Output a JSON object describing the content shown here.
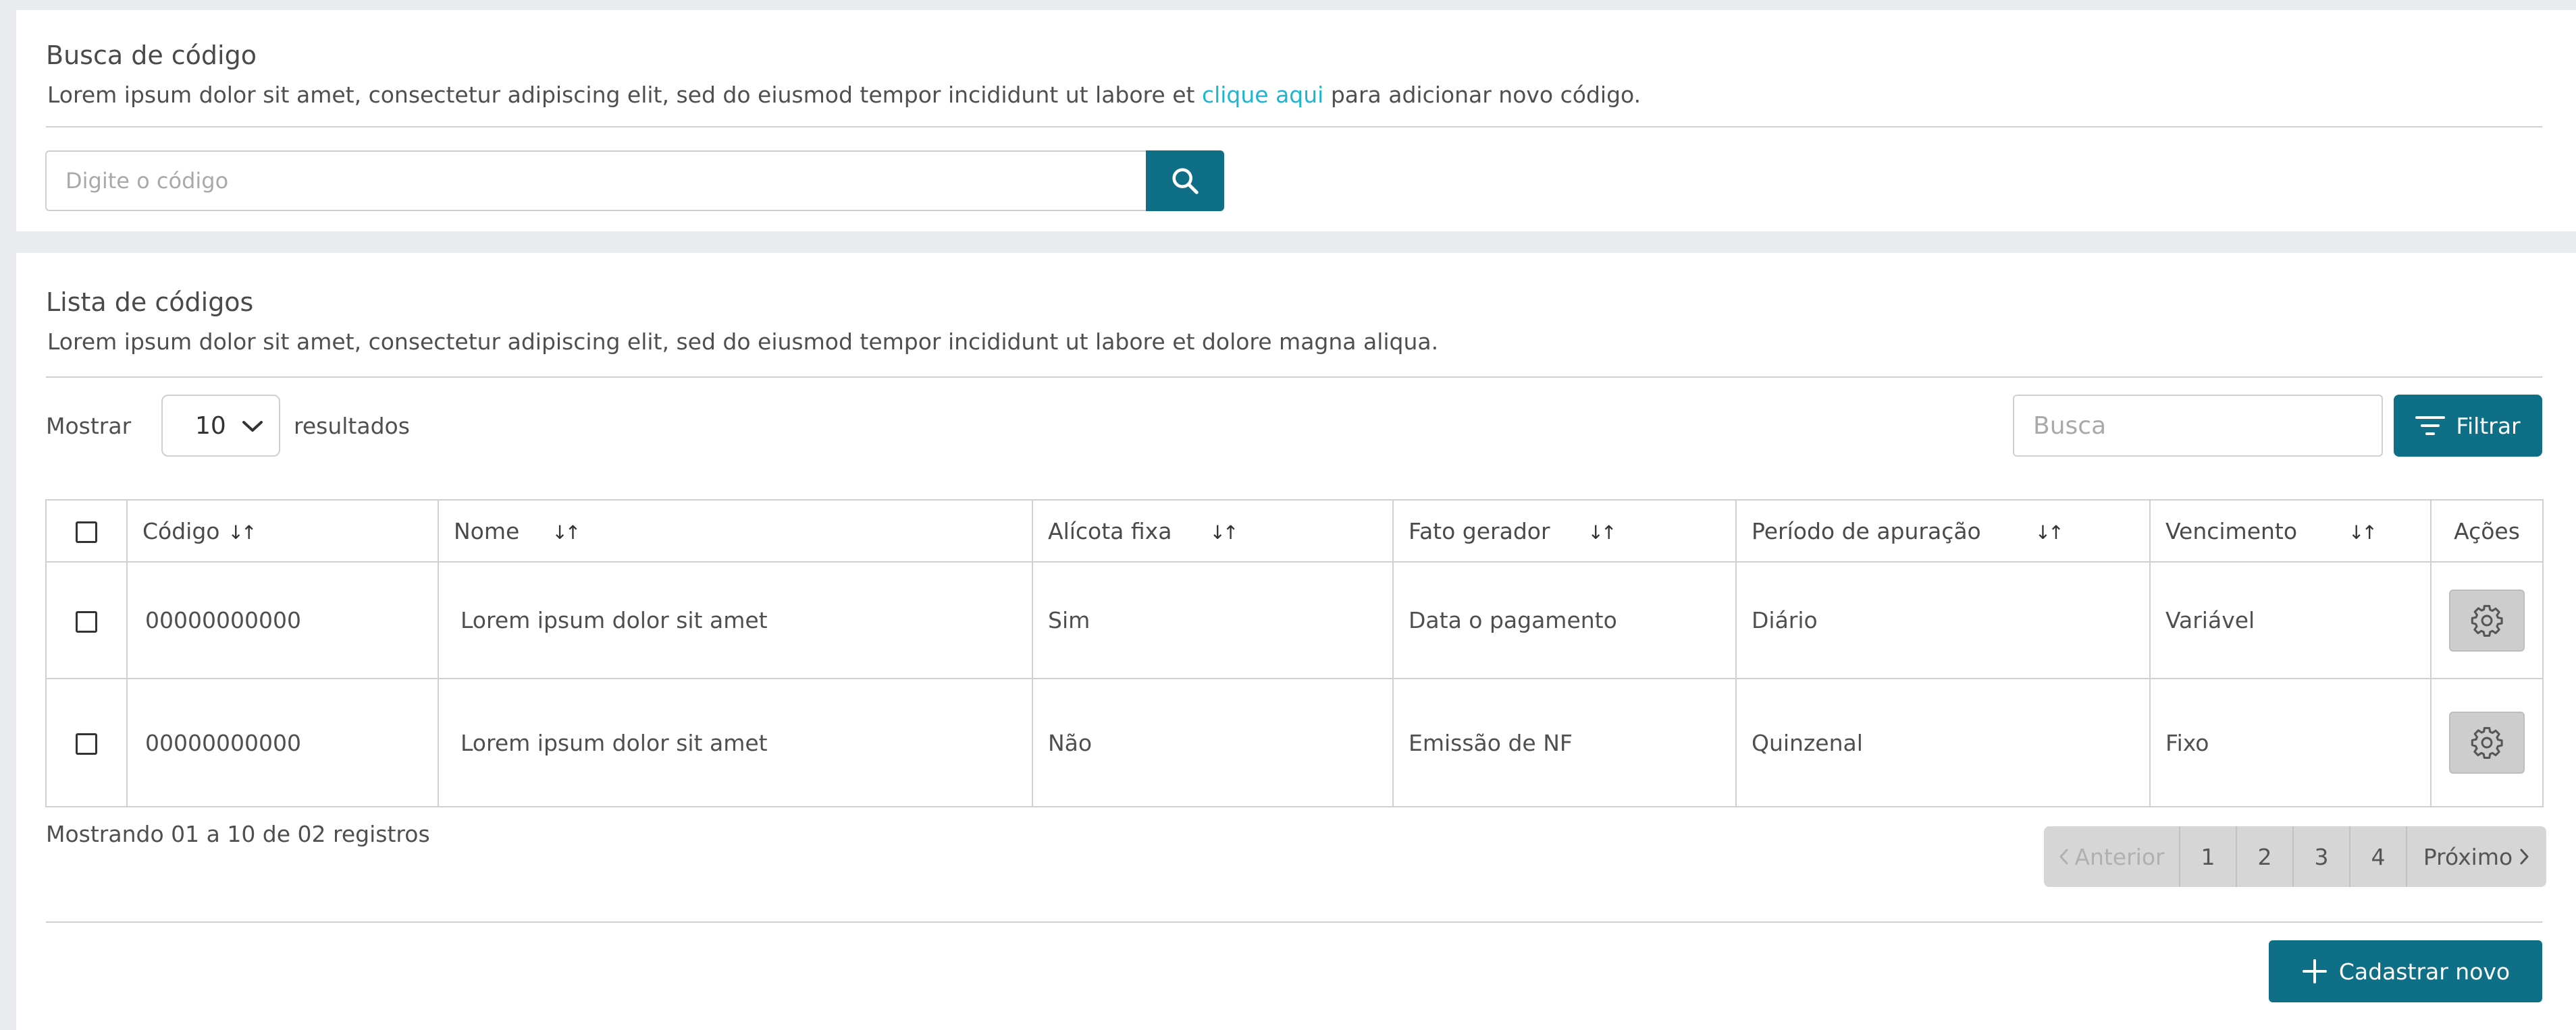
{
  "search_section": {
    "title": "Busca de código",
    "description_before_link": "Lorem ipsum dolor sit amet, consectetur adipiscing elit, sed do eiusmod tempor incididunt ut labore et ",
    "link_text": "clique aqui",
    "description_after_link": " para adicionar novo código.",
    "input_placeholder": "Digite o código",
    "search_icon": "search-icon"
  },
  "list_section": {
    "title": "Lista de códigos",
    "description": "Lorem ipsum dolor sit amet, consectetur adipiscing elit, sed do eiusmod tempor incididunt ut labore et dolore magna aliqua.",
    "show_label": "Mostrar",
    "page_size": "10",
    "results_label": "resultados",
    "search_placeholder": "Busca",
    "filter_label": "Filtrar",
    "filter_icon": "filter-icon"
  },
  "table": {
    "columns": [
      {
        "label": "Código",
        "sort": "↓↑"
      },
      {
        "label": "Nome",
        "sort": "↓↑"
      },
      {
        "label": "Alícota fixa",
        "sort": "↓↑"
      },
      {
        "label": "Fato gerador",
        "sort": "↓↑"
      },
      {
        "label": "Período de apuração",
        "sort": "↓↑"
      },
      {
        "label": "Vencimento",
        "sort": "↓↑"
      },
      {
        "label": "Ações"
      }
    ],
    "rows": [
      {
        "codigo": "00000000000",
        "nome": "Lorem ipsum dolor sit amet",
        "aliquota": "Sim",
        "fato": "Data o pagamento",
        "periodo": "Diário",
        "vencimento": "Variável"
      },
      {
        "codigo": "00000000000",
        "nome": "Lorem ipsum dolor sit amet",
        "aliquota": "Não",
        "fato": "Emissão de NF",
        "periodo": "Quinzenal",
        "vencimento": "Fixo"
      }
    ]
  },
  "footer": {
    "info": "Mostrando 01 a 10 de 02 registros",
    "prev_label": "Anterior",
    "pages": [
      "1",
      "2",
      "3",
      "4"
    ],
    "next_label": "Próximo",
    "new_button": "Cadastrar novo"
  },
  "colors": {
    "primary": "#0e6f86",
    "link": "#1fb5d0",
    "background": "#e9ecef"
  }
}
